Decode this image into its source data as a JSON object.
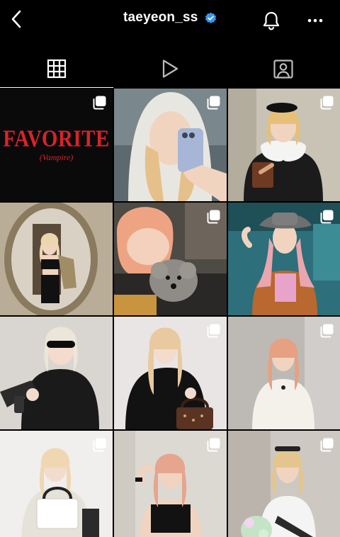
{
  "header": {
    "username": "taeyeon_ss",
    "verified_icon": "verified-badge-icon",
    "back_icon": "chevron-left-icon",
    "notifications_icon": "bell-icon",
    "more_icon": "more-horizontal-icon"
  },
  "tabs": [
    {
      "name": "posts-grid",
      "icon": "grid-icon",
      "active": true
    },
    {
      "name": "reels",
      "icon": "play-icon",
      "active": false
    },
    {
      "name": "tagged",
      "icon": "tagged-person-icon",
      "active": false
    }
  ],
  "posts": [
    {
      "id": "post-1",
      "caption_title": "FAVORITE",
      "caption_sub": "(Vampire)",
      "multi": true
    },
    {
      "id": "post-2",
      "multi": true
    },
    {
      "id": "post-3",
      "multi": true
    },
    {
      "id": "post-4",
      "multi": false
    },
    {
      "id": "post-5",
      "multi": true
    },
    {
      "id": "post-6",
      "multi": true
    },
    {
      "id": "post-7",
      "multi": false
    },
    {
      "id": "post-8",
      "multi": true
    },
    {
      "id": "post-9",
      "multi": true
    },
    {
      "id": "post-10",
      "multi": true
    },
    {
      "id": "post-11",
      "multi": true
    },
    {
      "id": "post-12",
      "multi": true
    }
  ],
  "colors": {
    "background": "#000000",
    "accent_red": "#d8232a",
    "verified_blue": "#3897f0"
  }
}
